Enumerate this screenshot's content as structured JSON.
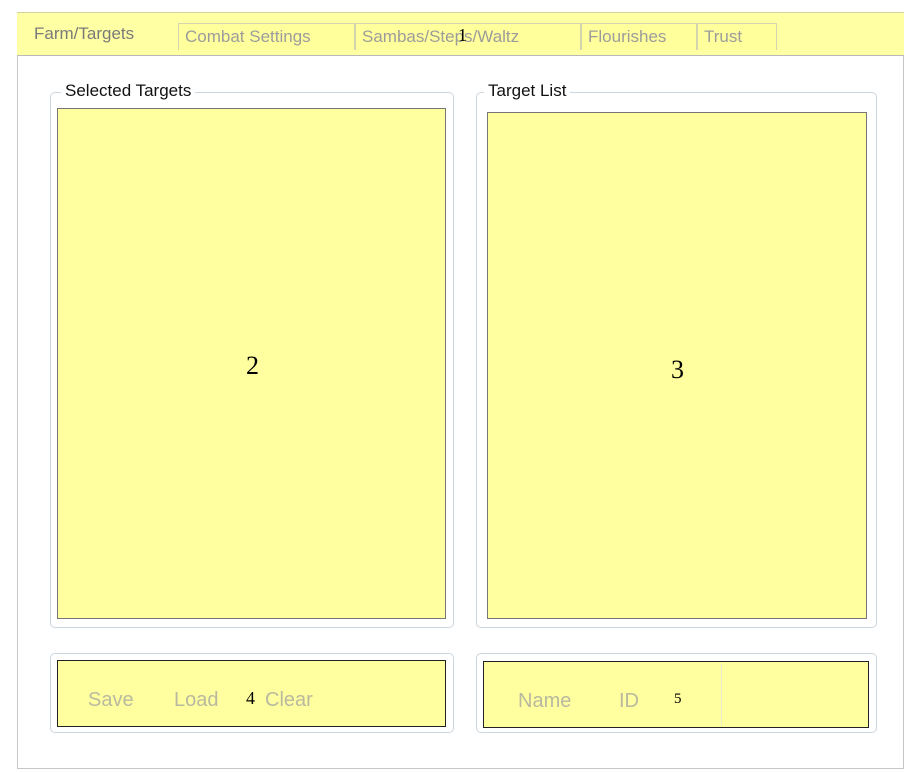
{
  "tabs": [
    {
      "label": "Farm/Targets",
      "active": true
    },
    {
      "label": "Combat Settings",
      "active": false
    },
    {
      "label": "Sambas/Steps/Waltz",
      "active": false
    },
    {
      "label": "Flourishes",
      "active": false
    },
    {
      "label": "Trust",
      "active": false
    }
  ],
  "groups": {
    "selected": {
      "title": "Selected Targets"
    },
    "target_list": {
      "title": "Target List"
    }
  },
  "left_bar": {
    "save": "Save",
    "load": "Load",
    "clear": "Clear"
  },
  "right_bar": {
    "name": "Name",
    "id": "ID"
  },
  "markers": {
    "m1": "1",
    "m2": "2",
    "m3": "3",
    "m4": "4",
    "m5": "5"
  },
  "colors": {
    "accent_yellow": "#ffff9f",
    "tab_text": "#9c9c9c"
  }
}
